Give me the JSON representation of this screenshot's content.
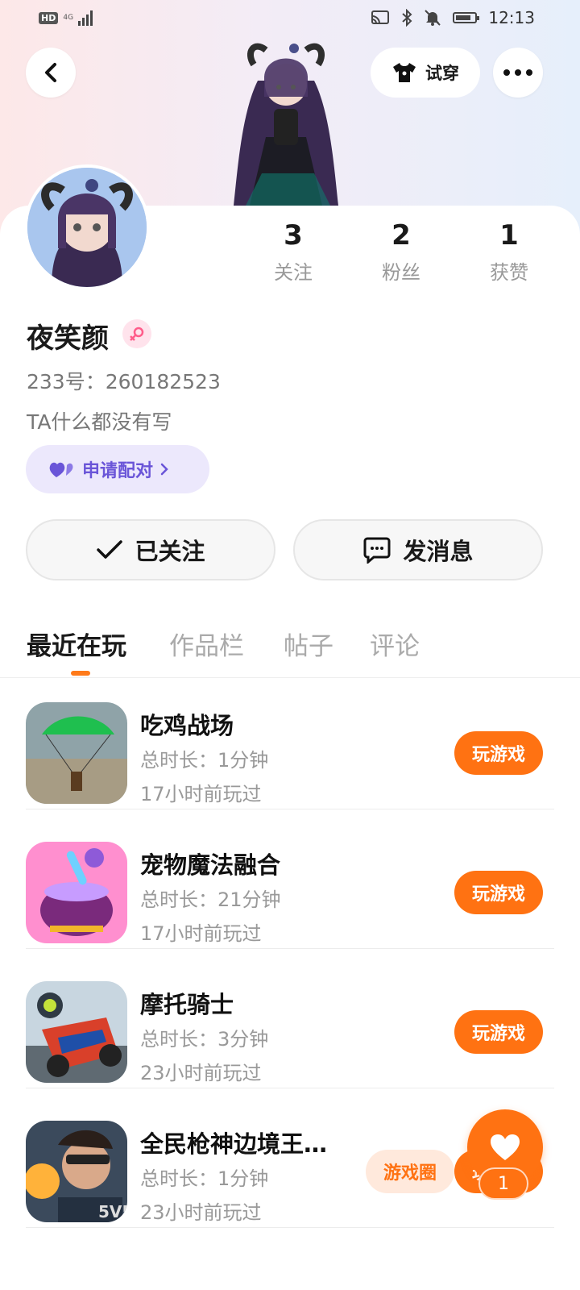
{
  "status_bar": {
    "hd": "HD",
    "network": "4G",
    "time": "12:13"
  },
  "header": {
    "try_on_label": "试穿"
  },
  "profile": {
    "username": "夜笑颜",
    "uid": "233号：260182523",
    "bio": "TA什么都没有写",
    "pair_label": "申请配对",
    "stats": [
      {
        "value": "3",
        "label": "关注"
      },
      {
        "value": "2",
        "label": "粉丝"
      },
      {
        "value": "1",
        "label": "获赞"
      }
    ],
    "following_label": "已关注",
    "message_label": "发消息"
  },
  "tabs": [
    {
      "label": "最近在玩",
      "active": true
    },
    {
      "label": "作品栏",
      "active": false
    },
    {
      "label": "帖子",
      "active": false
    },
    {
      "label": "评论",
      "active": false
    }
  ],
  "games": [
    {
      "name": "吃鸡战场",
      "duration": "总时长：1分钟",
      "last_played": "17小时前玩过",
      "button": "玩游戏"
    },
    {
      "name": "宠物魔法融合",
      "duration": "总时长：21分钟",
      "last_played": "17小时前玩过",
      "button": "玩游戏"
    },
    {
      "name": "摩托骑士",
      "duration": "总时长：3分钟",
      "last_played": "23小时前玩过",
      "button": "玩游戏"
    },
    {
      "name": "全民枪神边境王…",
      "duration": "总时长：1分钟",
      "last_played": "23小时前玩过",
      "button": "玩游戏",
      "circle_button": "游戏圈"
    }
  ],
  "float_like": {
    "count": "1"
  },
  "colors": {
    "accent": "#ff7212",
    "pair_purple": "#6a55d8"
  }
}
